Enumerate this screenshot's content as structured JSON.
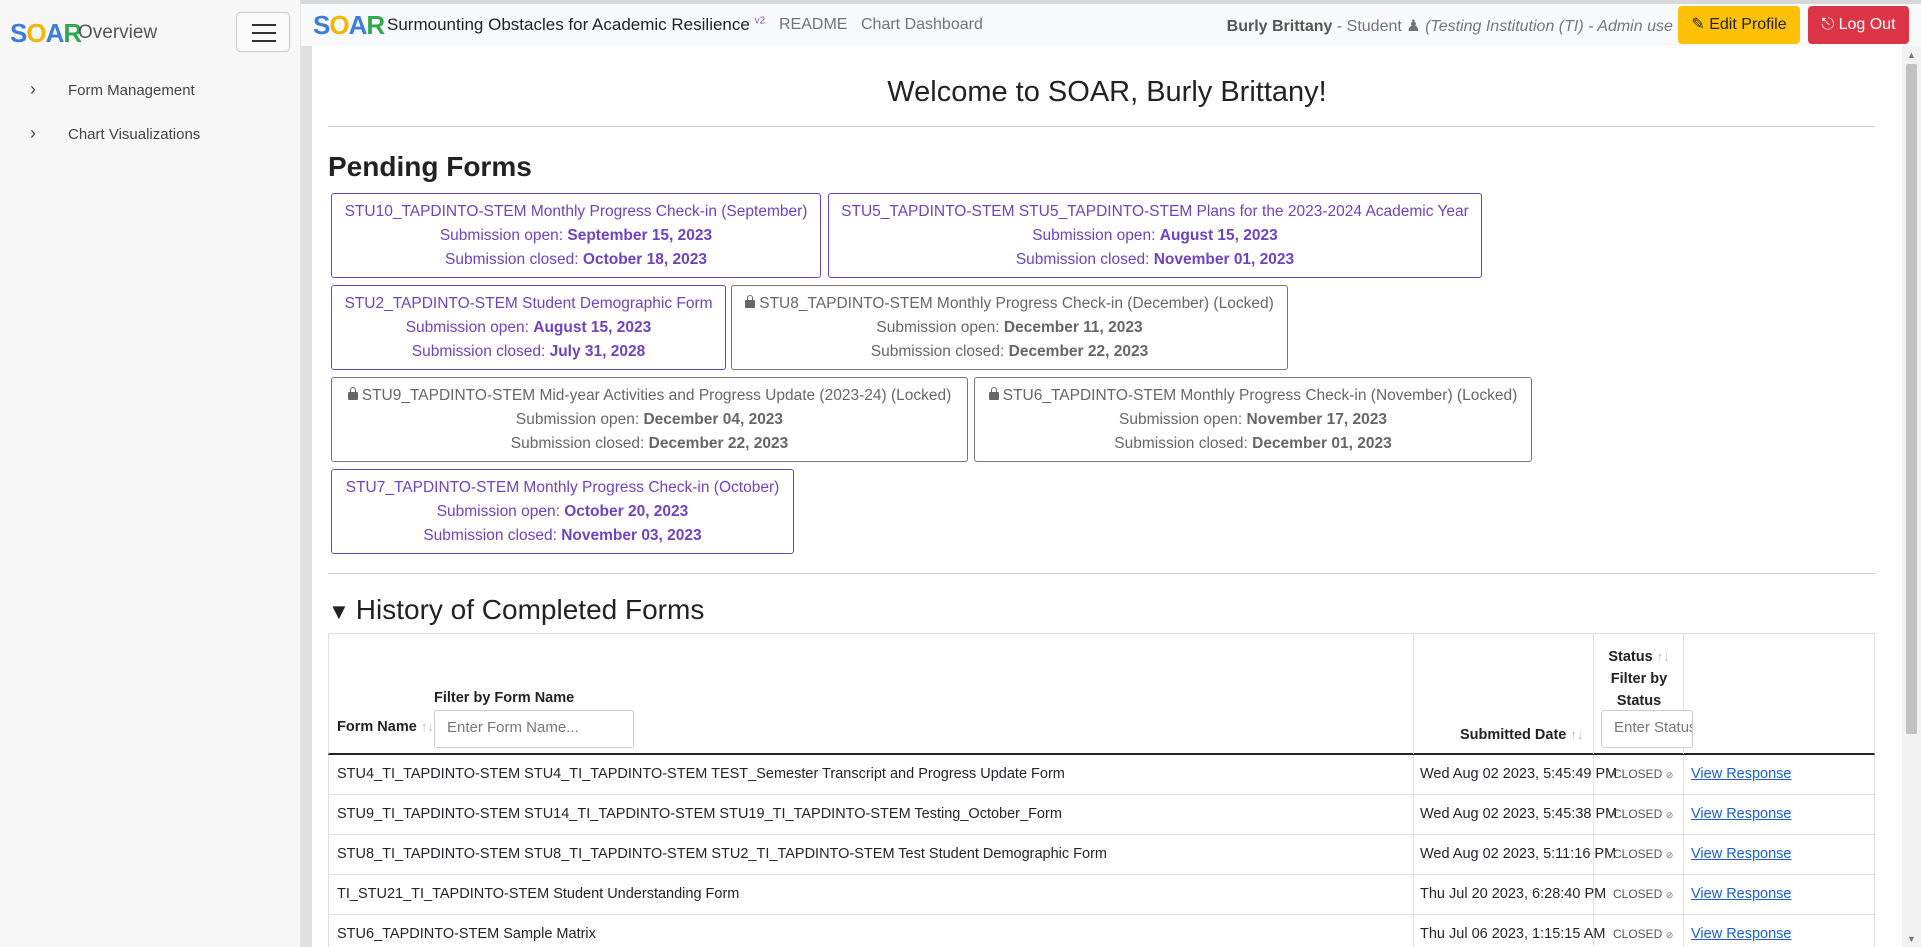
{
  "sidebar": {
    "logo": {
      "s": "S",
      "o": "O",
      "a": "A",
      "r": "R"
    },
    "title": "Overview",
    "items": [
      {
        "label": "Form Management"
      },
      {
        "label": "Chart Visualizations"
      }
    ]
  },
  "topbar": {
    "brand": "Surmounting Obstacles for Academic Resilience",
    "version": "v2",
    "links": [
      "README",
      "Chart Dashboard"
    ],
    "user_name": "Burly Brittany",
    "user_role": "- Student",
    "institution": "(Testing Institution (TI) - Admin use only)",
    "edit_profile": "Edit Profile",
    "log_out": "Log Out"
  },
  "main": {
    "welcome": "Welcome to SOAR, Burly Brittany!",
    "pending_title": "Pending Forms",
    "open_label": "Submission open:",
    "closed_label": "Submission closed:",
    "pending_forms": [
      {
        "name": "STU10_TAPDINTO-STEM Monthly Progress Check-in (September)",
        "open": "September 15, 2023",
        "closed": "October 18, 2023",
        "locked": false
      },
      {
        "name": "STU5_TAPDINTO-STEM STU5_TAPDINTO-STEM Plans for the 2023-2024 Academic Year",
        "open": "August 15, 2023",
        "closed": "November 01, 2023",
        "locked": false
      },
      {
        "name": "STU2_TAPDINTO-STEM Student Demographic Form",
        "open": "August 15, 2023",
        "closed": "July 31, 2028",
        "locked": false
      },
      {
        "name": "STU8_TAPDINTO-STEM Monthly Progress Check-in (December) (Locked)",
        "open": "December 11, 2023",
        "closed": "December 22, 2023",
        "locked": true
      },
      {
        "name": "STU9_TAPDINTO-STEM Mid-year Activities and Progress Update (2023-24) (Locked)",
        "open": "December 04, 2023",
        "closed": "December 22, 2023",
        "locked": true
      },
      {
        "name": "STU6_TAPDINTO-STEM Monthly Progress Check-in (November) (Locked)",
        "open": "November 17, 2023",
        "closed": "December 01, 2023",
        "locked": true
      },
      {
        "name": "STU7_TAPDINTO-STEM Monthly Progress Check-in (October)",
        "open": "October 20, 2023",
        "closed": "November 03, 2023",
        "locked": false
      }
    ],
    "history_title": "History of Completed Forms",
    "table": {
      "col_form_name": "Form Name",
      "filter_form_label": "Filter by Form Name",
      "filter_form_placeholder": "Enter Form Name...",
      "col_submitted": "Submitted Date",
      "col_status": "Status",
      "filter_status_label_1": "Filter by",
      "filter_status_label_2": "Status",
      "filter_status_placeholder": "Enter Status",
      "sort_glyph": "↑↓",
      "rows": [
        {
          "form": "STU4_TI_TAPDINTO-STEM STU4_TI_TAPDINTO-STEM TEST_Semester Transcript and Progress Update Form",
          "date": "Wed Aug 02 2023, 5:45:49 PM",
          "status": "CLOSED",
          "action": "View Response"
        },
        {
          "form": "STU9_TI_TAPDINTO-STEM STU14_TI_TAPDINTO-STEM STU19_TI_TAPDINTO-STEM Testing_October_Form",
          "date": "Wed Aug 02 2023, 5:45:38 PM",
          "status": "CLOSED",
          "action": "View Response"
        },
        {
          "form": "STU8_TI_TAPDINTO-STEM STU8_TI_TAPDINTO-STEM STU2_TI_TAPDINTO-STEM Test Student Demographic Form",
          "date": "Wed Aug 02 2023, 5:11:16 PM",
          "status": "CLOSED",
          "action": "View Response"
        },
        {
          "form": "TI_STU21_TI_TAPDINTO-STEM Student Understanding Form",
          "date": "Thu Jul 20 2023, 6:28:40 PM",
          "status": "CLOSED",
          "action": "View Response"
        },
        {
          "form": "STU6_TAPDINTO-STEM Sample Matrix",
          "date": "Thu Jul 06 2023, 1:15:15 AM",
          "status": "CLOSED",
          "action": "View Response"
        }
      ]
    }
  },
  "colors": {
    "brand_purple": "#6f42c1",
    "warning": "#ffc107",
    "danger": "#dc3545",
    "link": "#1a5fd0"
  }
}
